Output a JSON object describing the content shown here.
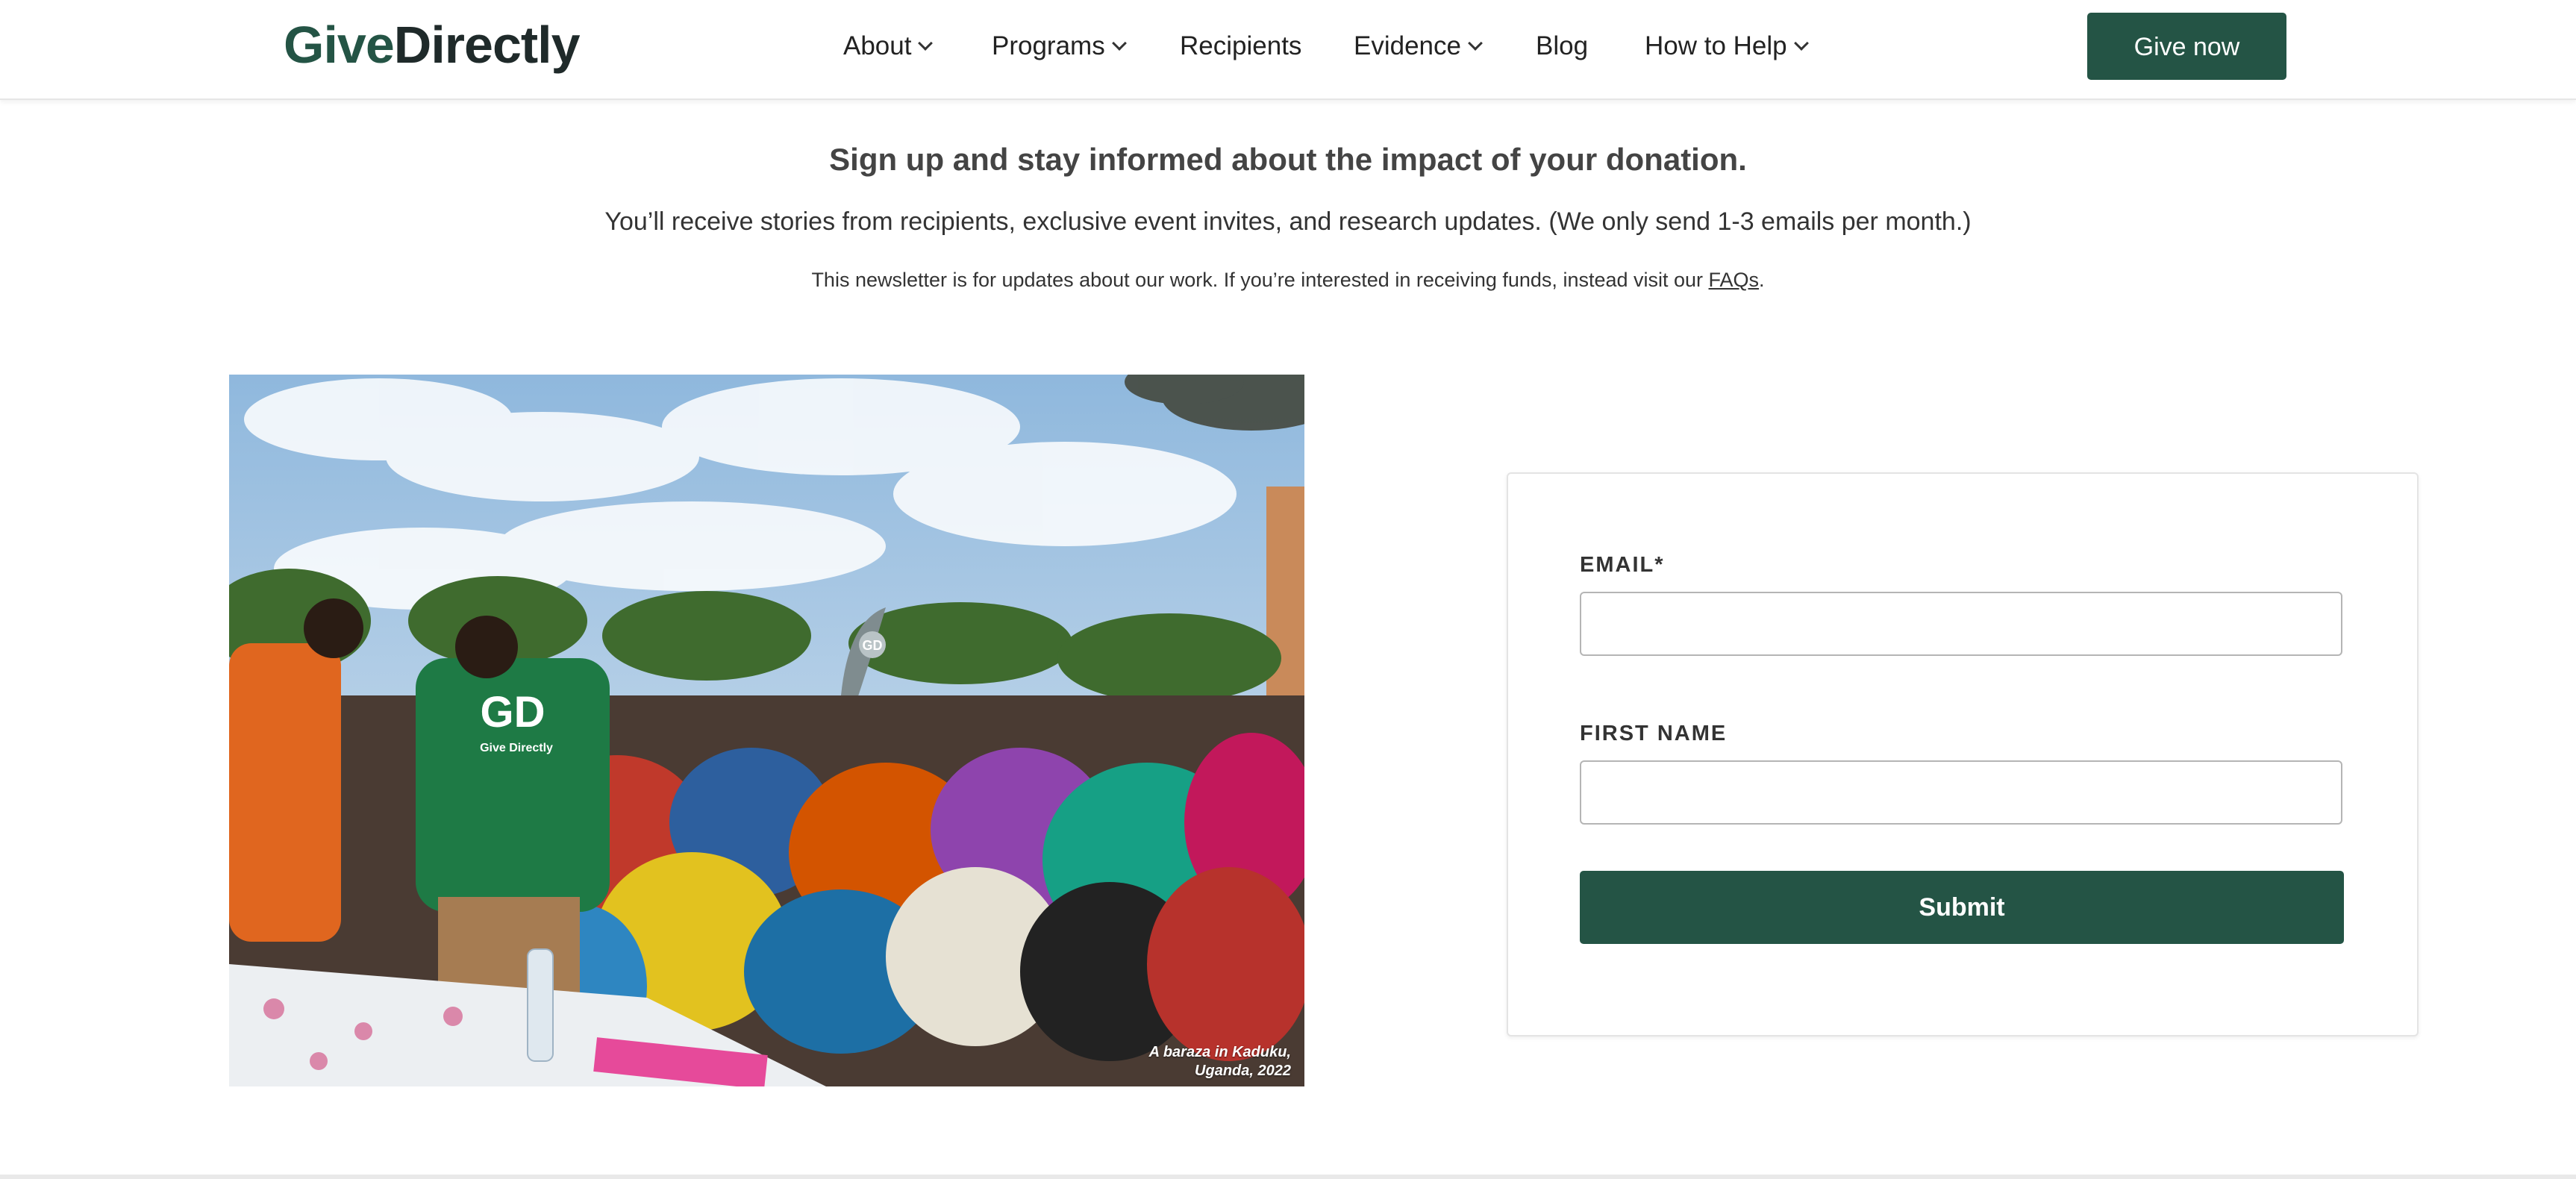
{
  "header": {
    "logo": {
      "part1": "Give",
      "part2": "Directly"
    },
    "nav": [
      {
        "label": "About",
        "dropdown": true
      },
      {
        "label": "Programs",
        "dropdown": true
      },
      {
        "label": "Recipients",
        "dropdown": false
      },
      {
        "label": "Evidence",
        "dropdown": true
      },
      {
        "label": "Blog",
        "dropdown": false
      },
      {
        "label": "How to Help",
        "dropdown": true
      }
    ],
    "cta_label": "Give now"
  },
  "intro": {
    "headline": "Sign up and stay informed about the impact of your donation.",
    "subline": "You’ll receive stories from recipients, exclusive event invites, and research updates. (We only send 1-3 emails per month.)",
    "note_prefix": "This newsletter is for updates about our work. If you’re interested in receiving funds, instead visit our ",
    "note_link": "FAQs",
    "note_suffix": "."
  },
  "photo": {
    "caption_line1": "A baraza in Kaduku,",
    "caption_line2": "Uganda, 2022",
    "shirt_logo": "GD",
    "shirt_text": "Give Directly",
    "flag_logo": "GD"
  },
  "form": {
    "email_label": "EMAIL*",
    "email_value": "",
    "first_name_label": "FIRST NAME",
    "first_name_value": "",
    "submit_label": "Submit"
  },
  "colors": {
    "brand_green": "#245445",
    "text_dark": "#222222"
  }
}
